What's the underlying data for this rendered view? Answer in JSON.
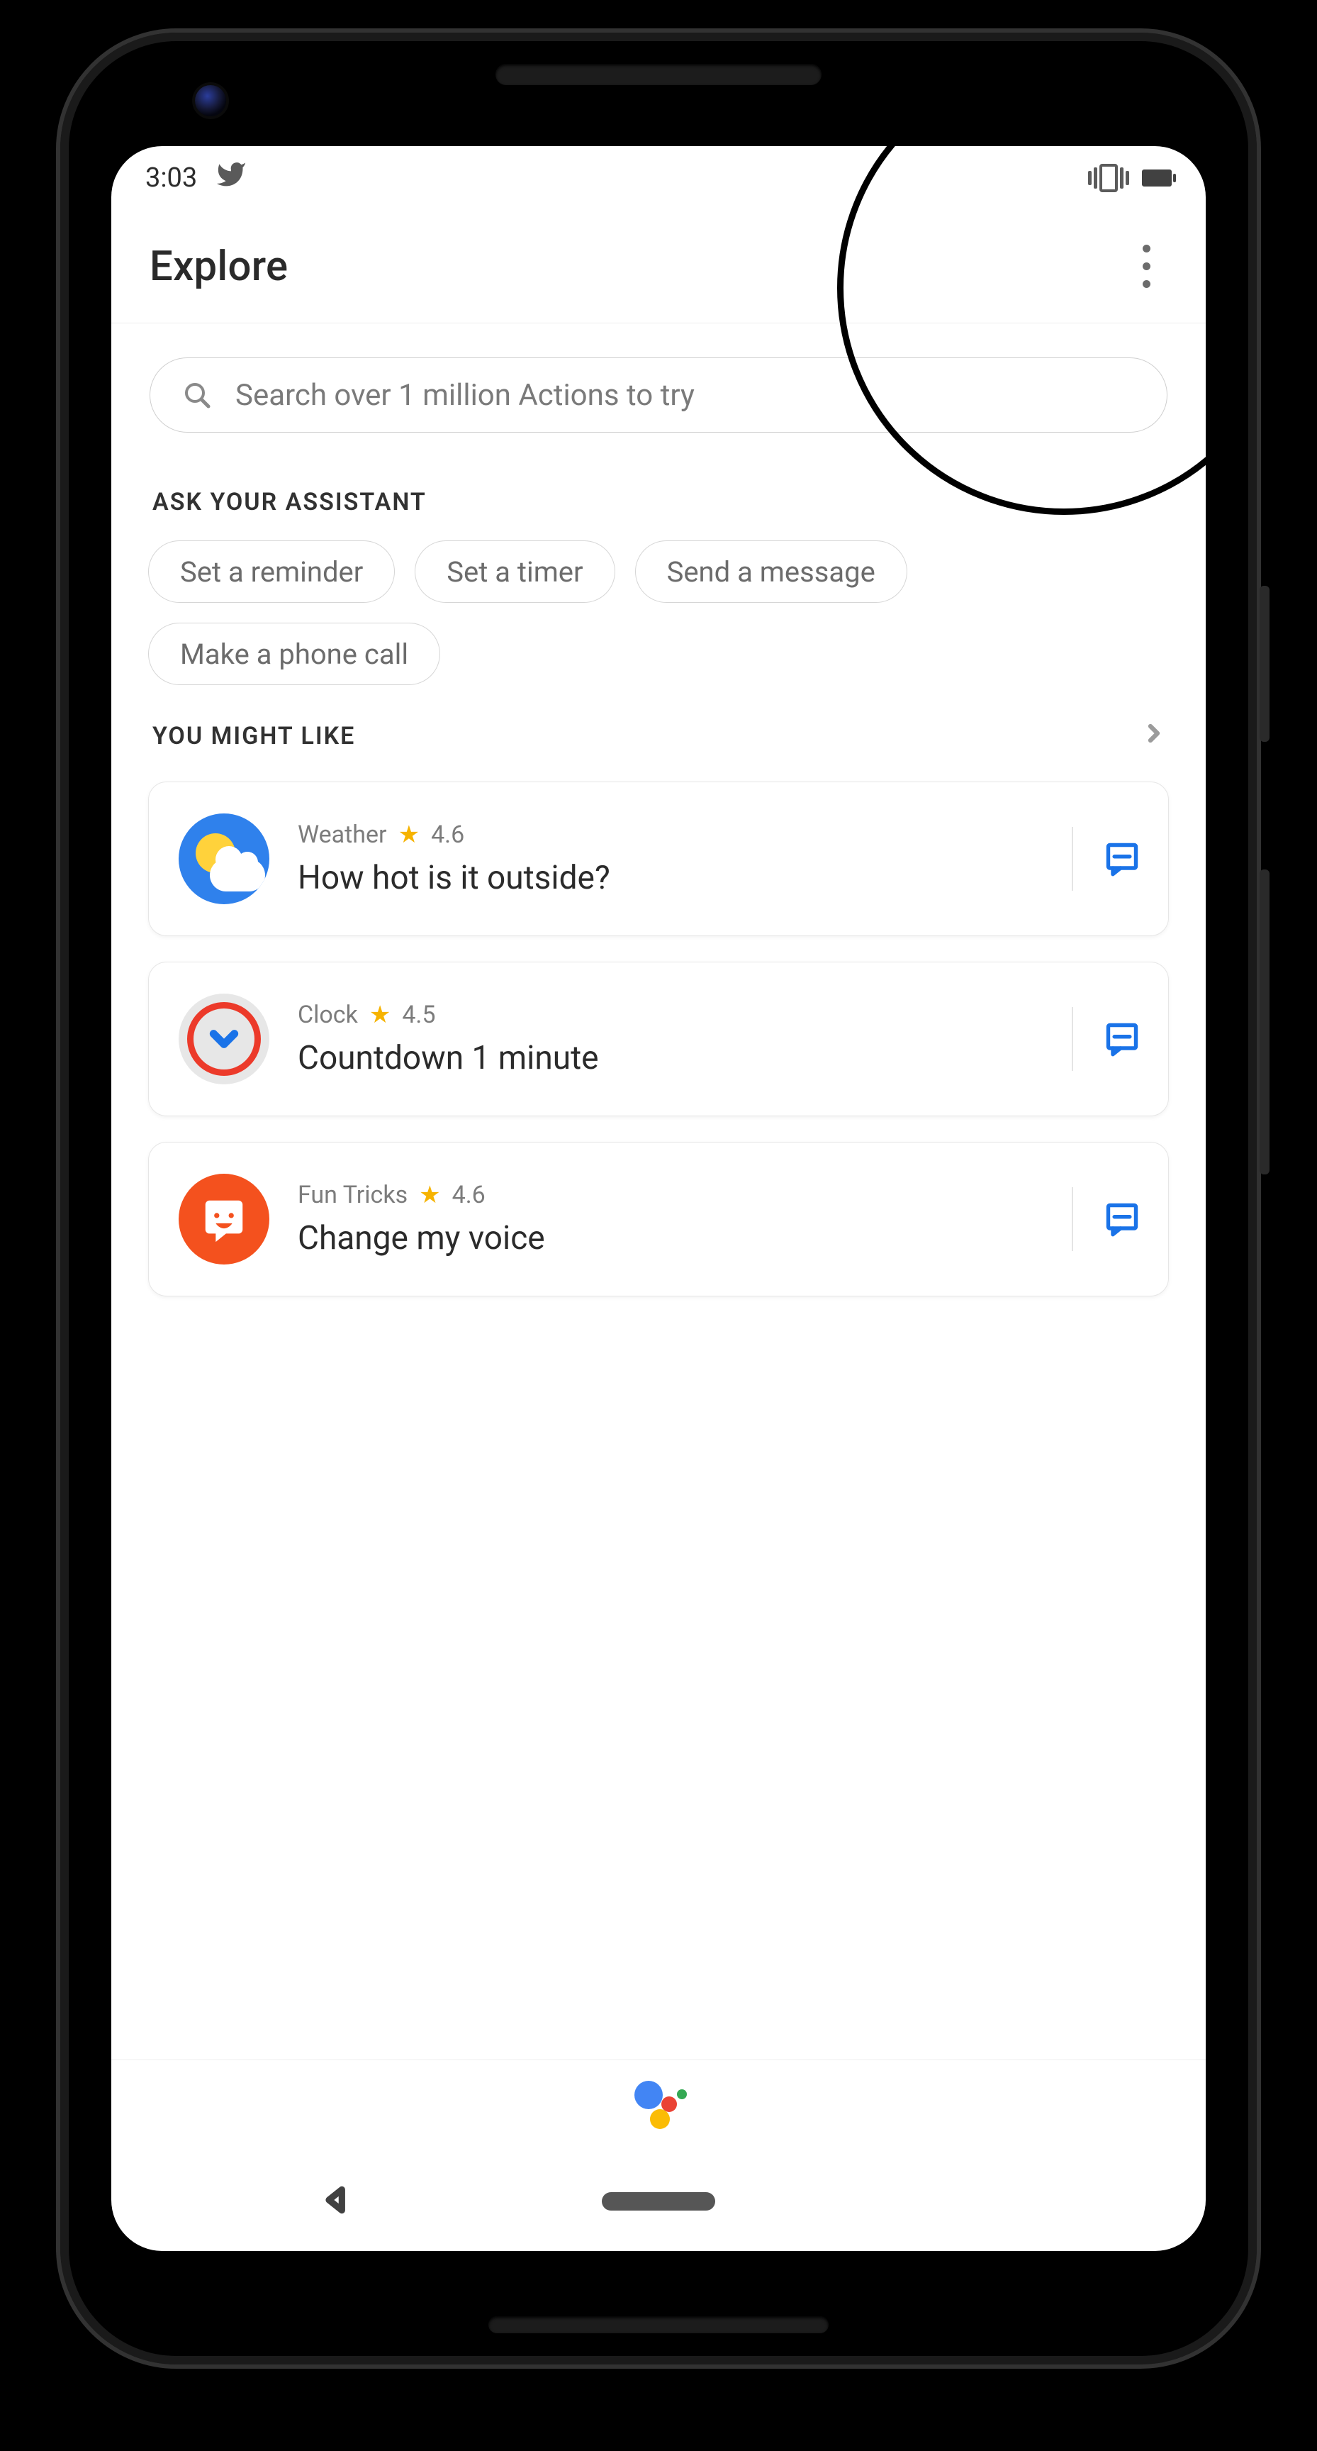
{
  "status": {
    "time": "3:03"
  },
  "header": {
    "title": "Explore"
  },
  "search": {
    "placeholder": "Search over 1 million Actions to try"
  },
  "ask": {
    "heading": "ASK YOUR ASSISTANT",
    "chips": [
      "Set a reminder",
      "Set a timer",
      "Send a message",
      "Make a phone call"
    ]
  },
  "like": {
    "heading": "YOU MIGHT LIKE",
    "cards": [
      {
        "category": "Weather",
        "rating": "4.6",
        "title": "How hot is it outside?"
      },
      {
        "category": "Clock",
        "rating": "4.5",
        "title": "Countdown 1 minute"
      },
      {
        "category": "Fun Tricks",
        "rating": "4.6",
        "title": "Change my voice"
      }
    ]
  }
}
